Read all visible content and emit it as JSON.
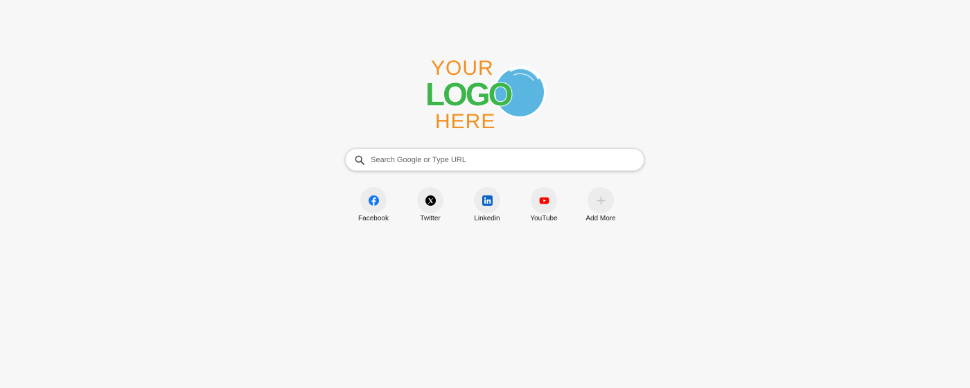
{
  "logo": {
    "line1": "YOUR",
    "line2": "LOGO",
    "line3": "HERE",
    "colors": {
      "orange": "#f0901e",
      "green": "#3cb54a",
      "blue": "#5ab6e0"
    }
  },
  "search": {
    "placeholder": "Search Google or Type URL",
    "value": "",
    "icon": "search-icon"
  },
  "shortcuts": [
    {
      "label": "Facebook",
      "icon": "facebook-icon",
      "color": "#1877f2"
    },
    {
      "label": "Twitter",
      "icon": "x-icon",
      "color": "#000000"
    },
    {
      "label": "Linkedin",
      "icon": "linkedin-icon",
      "color": "#0a66c2"
    },
    {
      "label": "YouTube",
      "icon": "youtube-icon",
      "color": "#ff0000"
    },
    {
      "label": "Add More",
      "icon": "plus-icon",
      "color": "#c7c7c7"
    }
  ]
}
